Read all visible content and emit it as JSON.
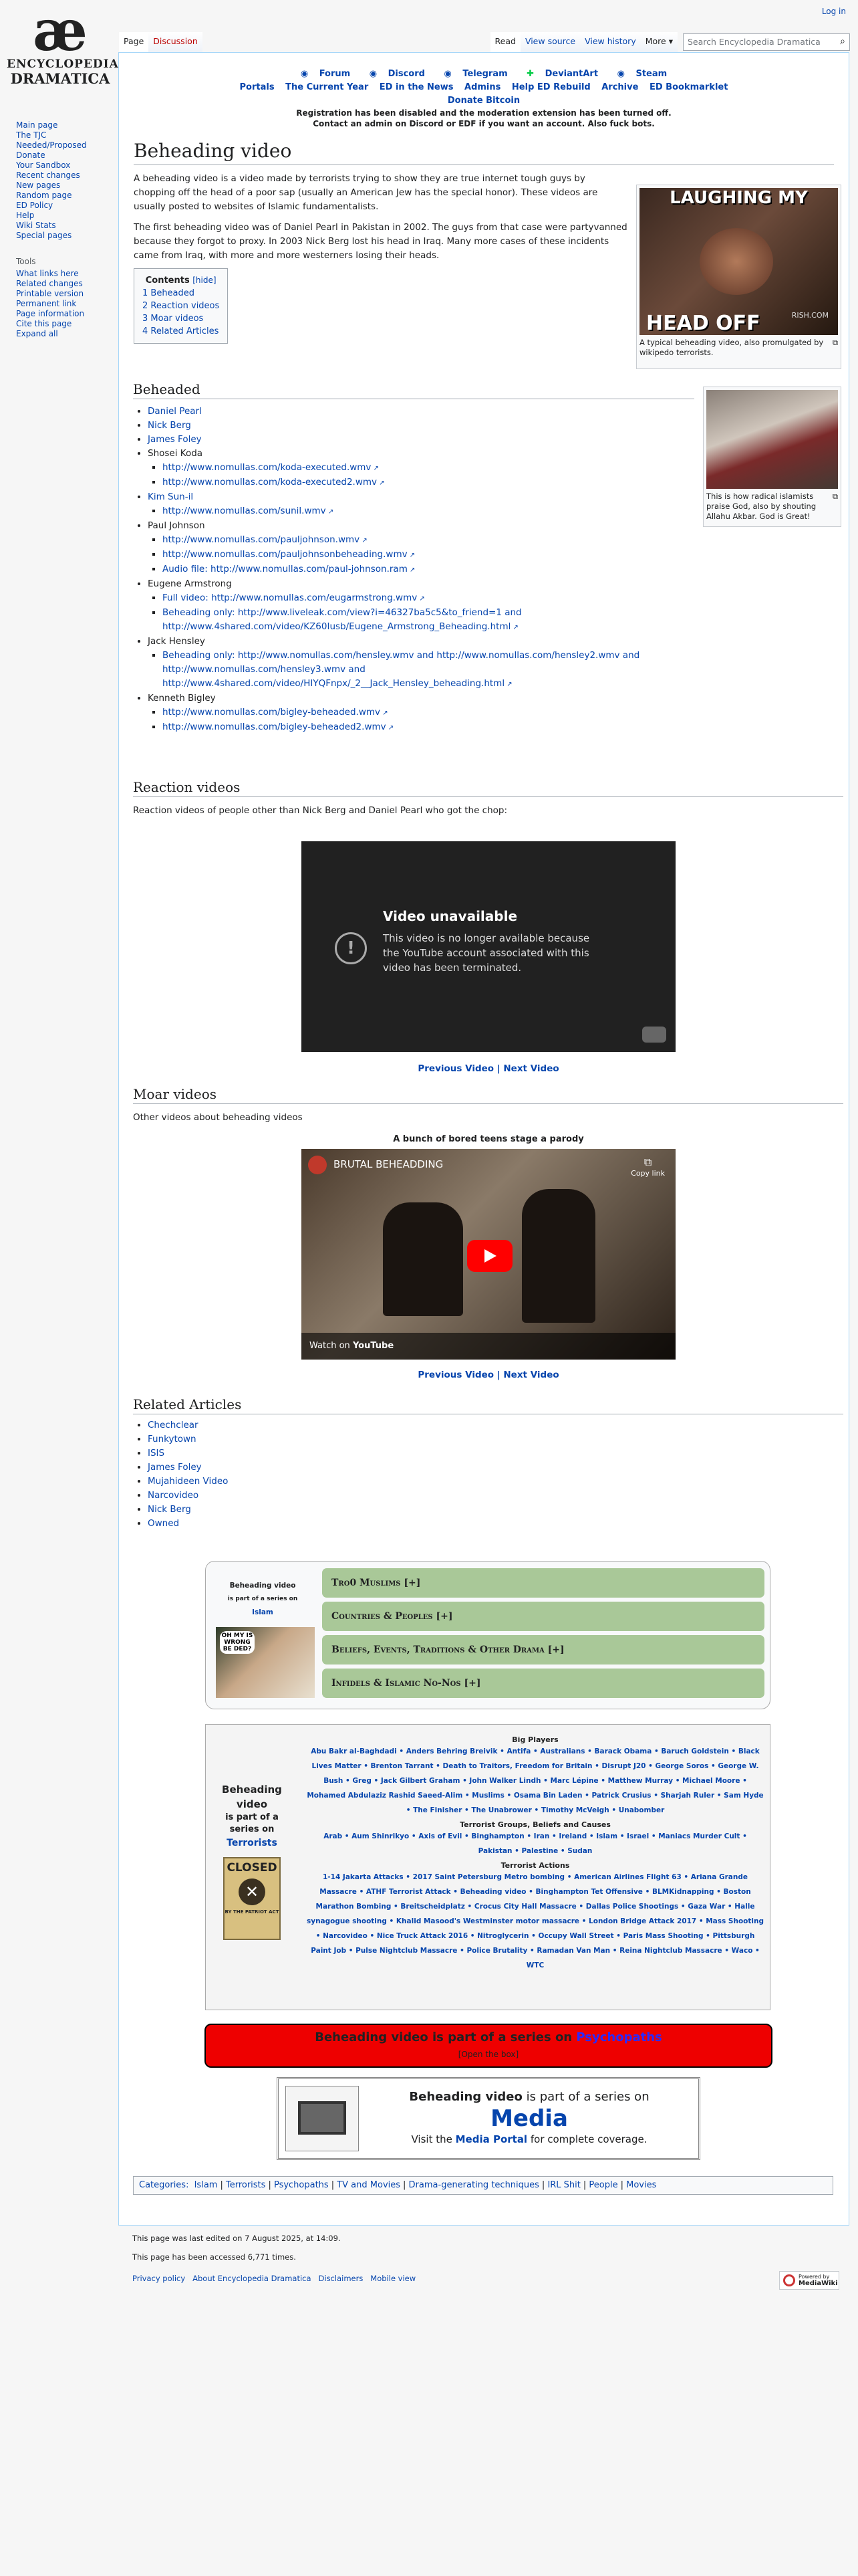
{
  "site": {
    "logo_top": "æ",
    "logo_line1": "ENCYCLOPEDIA",
    "logo_line2": "DRAMATICA",
    "login": "Log in"
  },
  "sidebar": {
    "nav": [
      "Main page",
      "The TJC",
      "Needed/Proposed",
      "Donate",
      "Your Sandbox",
      "Recent changes",
      "New pages",
      "Random page",
      "ED Policy",
      "Help",
      "Wiki Stats",
      "Special pages"
    ],
    "tools_header": "Tools",
    "tools": [
      "What links here",
      "Related changes",
      "Printable version",
      "Permanent link",
      "Page information",
      "Cite this page",
      "Expand all"
    ]
  },
  "tabs": {
    "page": "Page",
    "discussion": "Discussion",
    "read": "Read",
    "view_source": "View source",
    "view_history": "View history",
    "more": "More",
    "search_placeholder": "Search Encyclopedia Dramatica"
  },
  "notice": {
    "row1": [
      "Forum",
      "Discord",
      "Telegram",
      "DeviantArt",
      "Steam"
    ],
    "row2": [
      "Portals",
      "The Current Year",
      "ED in the News",
      "Admins",
      "Help ED Rebuild",
      "Archive",
      "ED Bookmarklet"
    ],
    "donate": "Donate Bitcoin",
    "msg1": "Registration has been disabled and the moderation extension has been turned off.",
    "msg2": "Contact an admin on Discord or EDF if you want an account. Also fuck bots."
  },
  "title": "Beheading video",
  "intro": {
    "p1": "A beheading video is a video made by terrorists trying to show they are true internet tough guys by chopping off the head of a poor sap (usually an American Jew has the special honor). These videos are usually posted to websites of Islamic fundamentalists.",
    "p2": "The first beheading video was of Daniel Pearl in Pakistan in 2002. The guys from that case were partyvanned because they forgot to proxy. In 2003 Nick Berg lost his head in Iraq. Many more cases of these incidents came from Iraq, with more and more westerners losing their heads."
  },
  "thumb1": {
    "top": "LAUGHING MY",
    "bottom": "HEAD OFF",
    "watermark": "RISH.COM",
    "caption": "A typical beheading video, also promulgated by wikipedo terrorists."
  },
  "thumb2": {
    "caption": "This is how radical islamists praise God, also by shouting Allahu Akbar. God is Great!"
  },
  "toc": {
    "title": "Contents",
    "hide": "[hide]",
    "items": [
      "1 Beheaded",
      "2 Reaction videos",
      "3 Moar videos",
      "4 Related Articles"
    ]
  },
  "beheaded": {
    "heading": "Beheaded",
    "items": [
      {
        "label": "Daniel Pearl",
        "sub": []
      },
      {
        "label": "Nick Berg",
        "sub": []
      },
      {
        "label": "James Foley",
        "sub": []
      },
      {
        "label": "Shosei Koda",
        "sub": [
          "http://www.nomullas.com/koda-executed.wmv",
          "http://www.nomullas.com/koda-executed2.wmv"
        ]
      },
      {
        "label": "Kim Sun-il",
        "sub": [
          "http://www.nomullas.com/sunil.wmv"
        ]
      },
      {
        "label": "Paul Johnson",
        "sub": [
          "http://www.nomullas.com/pauljohnson.wmv",
          "http://www.nomullas.com/pauljohnsonbeheading.wmv",
          "Audio file: http://www.nomullas.com/paul-johnson.ram"
        ]
      },
      {
        "label": "Eugene Armstrong",
        "sub": [
          "Full video: http://www.nomullas.com/eugarmstrong.wmv",
          "Beheading only: http://www.liveleak.com/view?i=46327ba5c5&to_friend=1 and http://www.4shared.com/video/KZ60Iusb/Eugene_Armstrong_Beheading.html"
        ]
      },
      {
        "label": "Jack Hensley",
        "sub": [
          "Beheading only: http://www.nomullas.com/hensley.wmv and http://www.nomullas.com/hensley2.wmv and http://www.nomullas.com/hensley3.wmv and http://www.4shared.com/video/HIYQFnpx/_2__Jack_Hensley_beheading.html"
        ]
      },
      {
        "label": "Kenneth Bigley",
        "sub": [
          "http://www.nomullas.com/bigley-beheaded.wmv",
          "http://www.nomullas.com/bigley-beheaded2.wmv"
        ]
      }
    ]
  },
  "reaction": {
    "heading": "Reaction videos",
    "text": "Reaction videos of people other than Nick Berg and Daniel Pearl who got the chop:",
    "video_title": "Video unavailable",
    "video_msg": "This video is no longer available because the YouTube account associated with this video has been terminated.",
    "nav": "Previous Video | Next Video"
  },
  "moar": {
    "heading": "Moar videos",
    "text": "Other videos about beheading videos",
    "caption": "A bunch of bored teens stage a parody",
    "video_title": "BRUTAL BEHEADDING",
    "copy_link": "Copy link",
    "watch_on": "Watch on",
    "youtube": "YouTube",
    "nav": "Previous Video | Next Video"
  },
  "related": {
    "heading": "Related Articles",
    "items": [
      "Chechclear",
      "Funkytown",
      "ISIS",
      "James Foley",
      "Mujahideen Video",
      "Narcovideo",
      "Nick Berg",
      "Owned"
    ]
  },
  "series1": {
    "label1": "Beheading video",
    "label2": "is part of a series on",
    "label3": "Islam",
    "img_text": "OH MY IS WRONG BE DED?",
    "rows": [
      "Tro0 Muslims [+]",
      "Countries & Peoples [+]",
      "Beliefs, Events, Traditions & Other Drama [+]",
      "Infidels & Islamic No-Nos [+]"
    ]
  },
  "series2": {
    "label1": "Beheading video",
    "label2": "is part of a series on",
    "label3": "Terrorists",
    "closed": "CLOSED",
    "closed_sub": "BY THE PATRIOT ACT",
    "g1h": "Big Players",
    "g1": "Abu Bakr al-Baghdadi • Anders Behring Breivik • Antifa • Australians • Barack Obama • Baruch Goldstein • Black Lives Matter • Brenton Tarrant • Death to Traitors, Freedom for Britain • Disrupt J20 • George Soros • George W. Bush • Greg • Jack Gilbert Graham • John Walker Lindh • Marc Lépine • Matthew Murray • Michael Moore • Mohamed Abdulaziz Rashid Saeed-Alim • Muslims • Osama Bin Laden • Patrick Crusius • Sharjah Ruler • Sam Hyde • The Finisher • The Unabrower • Timothy McVeigh • Unabomber",
    "g2h": "Terrorist Groups, Beliefs and Causes",
    "g2": "Arab • Aum Shinrikyo • Axis of Evil • Binghampton • Iran • Ireland • Islam • Israel • Maniacs Murder Cult • Pakistan • Palestine • Sudan",
    "g3h": "Terrorist Actions",
    "g3": "1-14 Jakarta Attacks • 2017 Saint Petersburg Metro bombing • American Airlines Flight 63 • Ariana Grande Massacre • ATHF Terrorist Attack • Beheading video • Binghampton Tet Offensive • BLMKidnapping • Boston Marathon Bombing • Breitscheidplatz • Crocus City Hall Massacre • Dallas Police Shootings • Gaza War • Halle synagogue shooting • Khalid Masood's Westminster motor massacre • London Bridge Attack 2017 • Mass Shooting • Narcovideo • Nice Truck Attack 2016 • Nitroglycerin • Occupy Wall Street • Paris Mass Shooting • Pittsburgh Paint Job • Pulse Nightclub Massacre • Police Brutality • Ramadan Van Man • Reina Nightclub Massacre • Waco • WTC"
  },
  "series3": {
    "text_a": "Beheading video is part of a series on ",
    "text_b": "Psychopaths",
    "open": "[Open the box]"
  },
  "series4": {
    "line1a": "Beheading video",
    "line1b": " is part of a series on",
    "big": "Media",
    "line3a": "Visit the ",
    "line3b": "Media Portal",
    "line3c": " for complete coverage."
  },
  "categories": {
    "label": "Categories:",
    "items": [
      "Islam",
      "Terrorists",
      "Psychopaths",
      "TV and Movies",
      "Drama-generating techniques",
      "IRL Shit",
      "People",
      "Movies"
    ]
  },
  "footer": {
    "edited": "This page was last edited on 7 August 2025, at 14:09.",
    "accessed": "This page has been accessed 6,771 times.",
    "links": [
      "Privacy policy",
      "About Encyclopedia Dramatica",
      "Disclaimers",
      "Mobile view"
    ],
    "powered1": "Powered by",
    "powered2": "MediaWiki"
  }
}
